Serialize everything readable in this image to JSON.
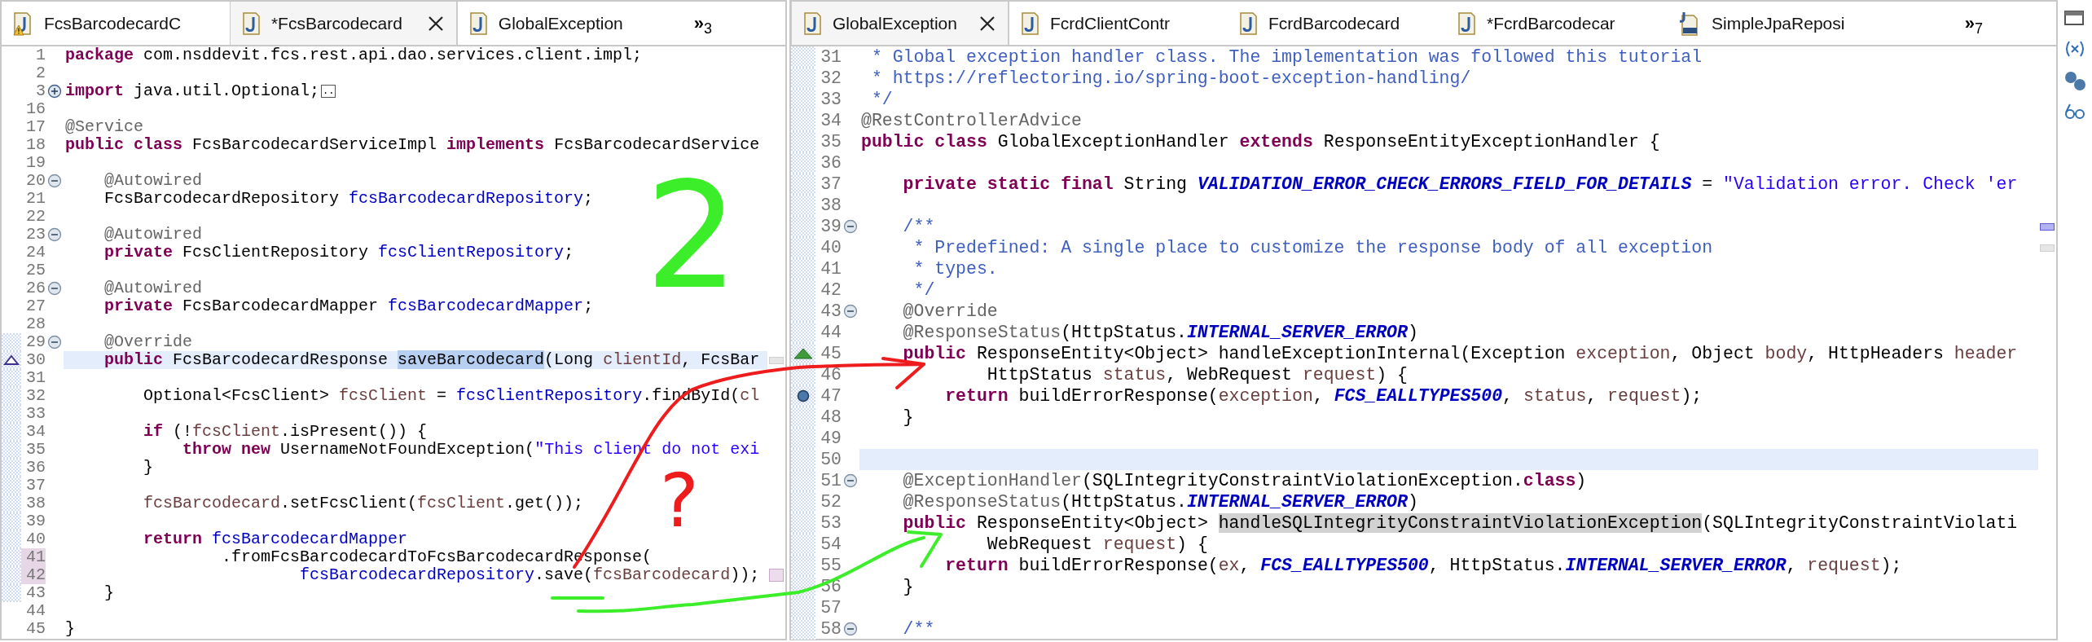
{
  "editors": [
    {
      "tabs": [
        {
          "title": "FcsBarcodecardC",
          "kind": "warning",
          "selected": false
        },
        {
          "title": "*FcsBarcodecard",
          "kind": "source",
          "selected": true
        },
        {
          "title": "GlobalException",
          "kind": "source",
          "selected": false
        }
      ],
      "more_tabs": {
        "symbol": "»",
        "count": "3"
      },
      "lines": [
        {
          "number": "1",
          "current": false,
          "in_range": false,
          "changed": false,
          "tokens": [
            {
              "kind": "keyword",
              "text": "package"
            },
            {
              "kind": "plain",
              "text": " com.nsddevit.fcs.rest.api.dao.services.client.impl;"
            }
          ]
        },
        {
          "number": "2",
          "current": false,
          "in_range": false,
          "changed": false
        },
        {
          "number": "3",
          "collapsed": true,
          "current": false,
          "in_range": false,
          "changed": false,
          "tokens": [
            {
              "kind": "keyword",
              "text": "import"
            },
            {
              "kind": "plain",
              "text": " java.util.Optional;"
            },
            {
              "kind": "folded",
              "text": ".."
            }
          ]
        },
        {
          "number": "16",
          "current": false,
          "in_range": false,
          "changed": false
        },
        {
          "number": "17",
          "current": false,
          "in_range": false,
          "changed": false,
          "tokens": [
            {
              "kind": "annotation",
              "text": "@Service"
            }
          ]
        },
        {
          "number": "18",
          "current": false,
          "in_range": false,
          "changed": false,
          "tokens": [
            {
              "kind": "keyword",
              "text": "public"
            },
            {
              "kind": "keyword",
              "text": " class"
            },
            {
              "kind": "plain",
              "text": " FcsBarcodecardServiceImpl "
            },
            {
              "kind": "keyword",
              "text": "implements"
            },
            {
              "kind": "plain",
              "text": " FcsBarcodecardService"
            }
          ]
        },
        {
          "number": "19",
          "current": false,
          "in_range": false,
          "changed": false
        },
        {
          "number": "20",
          "collapsed": false,
          "current": false,
          "in_range": false,
          "changed": false,
          "tokens": [
            {
              "kind": "annotation",
              "text": "    @Autowired"
            }
          ]
        },
        {
          "number": "21",
          "current": false,
          "in_range": false,
          "changed": false,
          "tokens": [
            {
              "kind": "plain",
              "text": "    FcsBarcodecardRepository "
            },
            {
              "kind": "field",
              "text": "fcsBarcodecardRepository"
            },
            {
              "kind": "plain",
              "text": ";"
            }
          ]
        },
        {
          "number": "22",
          "current": false,
          "in_range": false,
          "changed": false
        },
        {
          "number": "23",
          "collapsed": false,
          "current": false,
          "in_range": false,
          "changed": false,
          "tokens": [
            {
              "kind": "annotation",
              "text": "    @Autowired"
            }
          ]
        },
        {
          "number": "24",
          "current": false,
          "in_range": false,
          "changed": false,
          "tokens": [
            {
              "kind": "keyword",
              "text": "    private"
            },
            {
              "kind": "plain",
              "text": " FcsClientRepository "
            },
            {
              "kind": "field",
              "text": "fcsClientRepository"
            },
            {
              "kind": "plain",
              "text": ";"
            }
          ]
        },
        {
          "number": "25",
          "current": false,
          "in_range": false,
          "changed": false
        },
        {
          "number": "26",
          "collapsed": false,
          "current": false,
          "in_range": false,
          "changed": false,
          "tokens": [
            {
              "kind": "annotation",
              "text": "    @Autowired"
            }
          ]
        },
        {
          "number": "27",
          "current": false,
          "in_range": false,
          "changed": false,
          "tokens": [
            {
              "kind": "keyword",
              "text": "    private"
            },
            {
              "kind": "plain",
              "text": " FcsBarcodecardMapper "
            },
            {
              "kind": "field",
              "text": "fcsBarcodecardMapper"
            },
            {
              "kind": "plain",
              "text": ";"
            }
          ]
        },
        {
          "number": "28",
          "current": false,
          "in_range": false,
          "changed": false
        },
        {
          "number": "29",
          "collapsed": false,
          "current": false,
          "in_range": true,
          "changed": false,
          "tokens": [
            {
              "kind": "annotation",
              "text": "    @Override"
            }
          ]
        },
        {
          "number": "30",
          "override": true,
          "occurrence_mark": true,
          "current": true,
          "in_range": true,
          "changed": false,
          "tokens": [
            {
              "kind": "keyword",
              "text": "    public"
            },
            {
              "kind": "plain",
              "text": " FcsBarcodecardResponse "
            },
            {
              "kind": "selection",
              "text": "saveBarcodecard"
            },
            {
              "kind": "plain",
              "text": "(Long "
            },
            {
              "kind": "local",
              "text": "clientId"
            },
            {
              "kind": "plain",
              "text": ", FcsBar"
            }
          ]
        },
        {
          "number": "31",
          "current": false,
          "in_range": true,
          "changed": false
        },
        {
          "number": "32",
          "current": false,
          "in_range": true,
          "changed": false,
          "tokens": [
            {
              "kind": "plain",
              "text": "        Optional<FcsClient> "
            },
            {
              "kind": "local",
              "text": "fcsClient"
            },
            {
              "kind": "plain",
              "text": " = "
            },
            {
              "kind": "field",
              "text": "fcsClientRepository"
            },
            {
              "kind": "plain",
              "text": ".findById("
            },
            {
              "kind": "local",
              "text": "cl"
            }
          ]
        },
        {
          "number": "33",
          "current": false,
          "in_range": true,
          "changed": false
        },
        {
          "number": "34",
          "current": false,
          "in_range": true,
          "changed": false,
          "tokens": [
            {
              "kind": "keyword",
              "text": "        if"
            },
            {
              "kind": "plain",
              "text": " (!"
            },
            {
              "kind": "local",
              "text": "fcsClient"
            },
            {
              "kind": "plain",
              "text": ".isPresent()) {"
            }
          ]
        },
        {
          "number": "35",
          "current": false,
          "in_range": true,
          "changed": false,
          "tokens": [
            {
              "kind": "keyword",
              "text": "            throw"
            },
            {
              "kind": "keyword",
              "text": " new"
            },
            {
              "kind": "plain",
              "text": " UsernameNotFoundException("
            },
            {
              "kind": "string",
              "text": "\"This client do not exi"
            }
          ]
        },
        {
          "number": "36",
          "current": false,
          "in_range": true,
          "changed": false,
          "tokens": [
            {
              "kind": "plain",
              "text": "        }"
            }
          ]
        },
        {
          "number": "37",
          "current": false,
          "in_range": true,
          "changed": false
        },
        {
          "number": "38",
          "current": false,
          "in_range": true,
          "changed": false,
          "tokens": [
            {
              "kind": "local",
              "text": "        fcsBarcodecard"
            },
            {
              "kind": "plain",
              "text": ".setFcsClient("
            },
            {
              "kind": "local",
              "text": "fcsClient"
            },
            {
              "kind": "plain",
              "text": ".get());"
            }
          ]
        },
        {
          "number": "39",
          "current": false,
          "in_range": true,
          "changed": false
        },
        {
          "number": "40",
          "current": false,
          "in_range": true,
          "changed": false,
          "tokens": [
            {
              "kind": "keyword",
              "text": "        return"
            },
            {
              "kind": "field",
              "text": " fcsBarcodecardMapper"
            }
          ]
        },
        {
          "number": "41",
          "current": false,
          "in_range": true,
          "changed": true,
          "tokens": [
            {
              "kind": "plain",
              "text": "                .fromFcsBarcodecardToFcsBarcodecardResponse("
            }
          ]
        },
        {
          "number": "42",
          "change_mark": true,
          "current": false,
          "in_range": true,
          "changed": true,
          "tokens": [
            {
              "kind": "field",
              "text": "                        fcsBarcodecardRepository"
            },
            {
              "kind": "plain",
              "text": ".save("
            },
            {
              "kind": "local",
              "text": "fcsBarcodecard"
            },
            {
              "kind": "plain",
              "text": "));"
            }
          ]
        },
        {
          "number": "43",
          "current": false,
          "in_range": true,
          "changed": false,
          "tokens": [
            {
              "kind": "plain",
              "text": "    }"
            }
          ]
        },
        {
          "number": "44",
          "current": false,
          "in_range": false,
          "changed": false
        },
        {
          "number": "45",
          "current": false,
          "in_range": false,
          "changed": false,
          "tokens": [
            {
              "kind": "plain",
              "text": "}"
            }
          ]
        }
      ]
    },
    {
      "tabs": [
        {
          "title": "GlobalException",
          "kind": "source",
          "selected": true
        },
        {
          "title": "FcrdClientContr",
          "kind": "source",
          "selected": false
        },
        {
          "title": "FcrdBarcodecard",
          "kind": "source",
          "selected": false
        },
        {
          "title": "*FcrdBarcodecar",
          "kind": "source",
          "selected": false
        },
        {
          "title": "SimpleJpaReposi",
          "kind": "binary",
          "selected": false
        }
      ],
      "more_tabs": {
        "symbol": "»",
        "count": "7"
      },
      "lines": [
        {
          "number": "31",
          "current": false,
          "in_range": true,
          "changed": false,
          "tokens": [
            {
              "kind": "javadoc",
              "text": " * Global exception handler class. The implementation was followed this tutorial"
            }
          ]
        },
        {
          "number": "32",
          "current": false,
          "in_range": true,
          "changed": false,
          "tokens": [
            {
              "kind": "javadoc",
              "text": " * https://reflectoring.io/spring-boot-exception-handling/"
            }
          ]
        },
        {
          "number": "33",
          "current": false,
          "in_range": true,
          "changed": false,
          "tokens": [
            {
              "kind": "javadoc",
              "text": " */"
            }
          ]
        },
        {
          "number": "34",
          "current": false,
          "in_range": true,
          "changed": false,
          "tokens": [
            {
              "kind": "annotation",
              "text": "@RestControllerAdvice"
            }
          ]
        },
        {
          "number": "35",
          "current": false,
          "in_range": true,
          "changed": false,
          "tokens": [
            {
              "kind": "keyword",
              "text": "public"
            },
            {
              "kind": "keyword",
              "text": " class"
            },
            {
              "kind": "plain",
              "text": " GlobalExceptionHandler "
            },
            {
              "kind": "keyword",
              "text": "extends"
            },
            {
              "kind": "plain",
              "text": " ResponseEntityExceptionHandler {"
            }
          ]
        },
        {
          "number": "36",
          "current": false,
          "in_range": true,
          "changed": false
        },
        {
          "number": "37",
          "current": false,
          "in_range": true,
          "changed": false,
          "tokens": [
            {
              "kind": "keyword",
              "text": "    private"
            },
            {
              "kind": "keyword",
              "text": " static"
            },
            {
              "kind": "keyword",
              "text": " final"
            },
            {
              "kind": "plain",
              "text": " String "
            },
            {
              "kind": "constant",
              "text": "VALIDATION_ERROR_CHECK_ERRORS_FIELD_FOR_DETAILS"
            },
            {
              "kind": "plain",
              "text": " = "
            },
            {
              "kind": "string",
              "text": "\"Validation error. Check 'er"
            }
          ]
        },
        {
          "number": "38",
          "current": false,
          "in_range": true,
          "changed": false
        },
        {
          "number": "39",
          "collapsed": false,
          "bookmark": true,
          "current": false,
          "in_range": true,
          "changed": false,
          "tokens": [
            {
              "kind": "javadoc",
              "text": "    /**"
            }
          ]
        },
        {
          "number": "40",
          "occurrence_mark": true,
          "current": false,
          "in_range": true,
          "changed": false,
          "tokens": [
            {
              "kind": "javadoc",
              "text": "     * Predefined: A single place to customize the response body of all exception"
            }
          ]
        },
        {
          "number": "41",
          "current": false,
          "in_range": true,
          "changed": false,
          "tokens": [
            {
              "kind": "javadoc",
              "text": "     * types."
            }
          ]
        },
        {
          "number": "42",
          "current": false,
          "in_range": true,
          "changed": false,
          "tokens": [
            {
              "kind": "javadoc",
              "text": "     */"
            }
          ]
        },
        {
          "number": "43",
          "collapsed": false,
          "current": false,
          "in_range": true,
          "changed": false,
          "tokens": [
            {
              "kind": "annotation",
              "text": "    @Override"
            }
          ]
        },
        {
          "number": "44",
          "current": false,
          "in_range": true,
          "changed": false,
          "tokens": [
            {
              "kind": "annotation",
              "text": "    @ResponseStatus"
            },
            {
              "kind": "plain",
              "text": "(HttpStatus."
            },
            {
              "kind": "constant",
              "text": "INTERNAL_SERVER_ERROR"
            },
            {
              "kind": "plain",
              "text": ")"
            }
          ]
        },
        {
          "number": "45",
          "implements": true,
          "current": false,
          "in_range": true,
          "changed": false,
          "tokens": [
            {
              "kind": "keyword",
              "text": "    public"
            },
            {
              "kind": "plain",
              "text": " ResponseEntity<Object> handleExceptionInternal(Exception "
            },
            {
              "kind": "local",
              "text": "exception"
            },
            {
              "kind": "plain",
              "text": ", Object "
            },
            {
              "kind": "local",
              "text": "body"
            },
            {
              "kind": "plain",
              "text": ", HttpHeaders "
            },
            {
              "kind": "local",
              "text": "header"
            }
          ]
        },
        {
          "number": "46",
          "current": false,
          "in_range": true,
          "changed": false,
          "tokens": [
            {
              "kind": "plain",
              "text": "            HttpStatus "
            },
            {
              "kind": "local",
              "text": "status"
            },
            {
              "kind": "plain",
              "text": ", WebRequest "
            },
            {
              "kind": "local",
              "text": "request"
            },
            {
              "kind": "plain",
              "text": ") {"
            }
          ]
        },
        {
          "number": "47",
          "breakpoint": true,
          "current": false,
          "in_range": true,
          "changed": false,
          "tokens": [
            {
              "kind": "keyword",
              "text": "        return"
            },
            {
              "kind": "plain",
              "text": " buildErrorResponse("
            },
            {
              "kind": "local",
              "text": "exception"
            },
            {
              "kind": "plain",
              "text": ", "
            },
            {
              "kind": "constant",
              "text": "FCS_EALLTYPES500"
            },
            {
              "kind": "plain",
              "text": ", "
            },
            {
              "kind": "local",
              "text": "status"
            },
            {
              "kind": "plain",
              "text": ", "
            },
            {
              "kind": "local",
              "text": "request"
            },
            {
              "kind": "plain",
              "text": ");"
            }
          ]
        },
        {
          "number": "48",
          "current": false,
          "in_range": true,
          "changed": false,
          "tokens": [
            {
              "kind": "plain",
              "text": "    }"
            }
          ]
        },
        {
          "number": "49",
          "current": false,
          "in_range": true,
          "changed": false
        },
        {
          "number": "50",
          "current": true,
          "in_range": true,
          "changed": false
        },
        {
          "number": "51",
          "collapsed": false,
          "current": false,
          "in_range": true,
          "changed": false,
          "tokens": [
            {
              "kind": "annotation",
              "text": "    @ExceptionHandler"
            },
            {
              "kind": "plain",
              "text": "(SQLIntegrityConstraintViolationException."
            },
            {
              "kind": "keyword",
              "text": "class"
            },
            {
              "kind": "plain",
              "text": ")"
            }
          ]
        },
        {
          "number": "52",
          "current": false,
          "in_range": true,
          "changed": false,
          "tokens": [
            {
              "kind": "annotation",
              "text": "    @ResponseStatus"
            },
            {
              "kind": "plain",
              "text": "(HttpStatus."
            },
            {
              "kind": "constant",
              "text": "INTERNAL_SERVER_ERROR"
            },
            {
              "kind": "plain",
              "text": ")"
            }
          ]
        },
        {
          "number": "53",
          "current": false,
          "in_range": true,
          "changed": false,
          "tokens": [
            {
              "kind": "keyword",
              "text": "    public"
            },
            {
              "kind": "plain",
              "text": " ResponseEntity<Object> "
            },
            {
              "kind": "occurrence",
              "text": "handleSQLIntegrityConstraintViolationException"
            },
            {
              "kind": "plain",
              "text": "(SQLIntegrityConstraintViolati"
            }
          ]
        },
        {
          "number": "54",
          "current": false,
          "in_range": true,
          "changed": false,
          "tokens": [
            {
              "kind": "plain",
              "text": "            WebRequest "
            },
            {
              "kind": "local",
              "text": "request"
            },
            {
              "kind": "plain",
              "text": ") {"
            }
          ]
        },
        {
          "number": "55",
          "current": false,
          "in_range": true,
          "changed": false,
          "tokens": [
            {
              "kind": "keyword",
              "text": "        return"
            },
            {
              "kind": "plain",
              "text": " buildErrorResponse("
            },
            {
              "kind": "local",
              "text": "ex"
            },
            {
              "kind": "plain",
              "text": ", "
            },
            {
              "kind": "constant",
              "text": "FCS_EALLTYPES500"
            },
            {
              "kind": "plain",
              "text": ", HttpStatus."
            },
            {
              "kind": "constant",
              "text": "INTERNAL_SERVER_ERROR"
            },
            {
              "kind": "plain",
              "text": ", "
            },
            {
              "kind": "local",
              "text": "request"
            },
            {
              "kind": "plain",
              "text": ");"
            }
          ]
        },
        {
          "number": "56",
          "current": false,
          "in_range": true,
          "changed": false,
          "tokens": [
            {
              "kind": "plain",
              "text": "    }"
            }
          ]
        },
        {
          "number": "57",
          "current": false,
          "in_range": true,
          "changed": false
        },
        {
          "number": "58",
          "collapsed": false,
          "current": false,
          "in_range": true,
          "changed": false,
          "tokens": [
            {
              "kind": "javadoc",
              "text": "    /**"
            }
          ]
        }
      ]
    }
  ],
  "handwritten_notes": [
    {
      "text": "2",
      "color": "#3cee2a"
    },
    {
      "text": "?",
      "color": "#ee1c1c"
    }
  ]
}
